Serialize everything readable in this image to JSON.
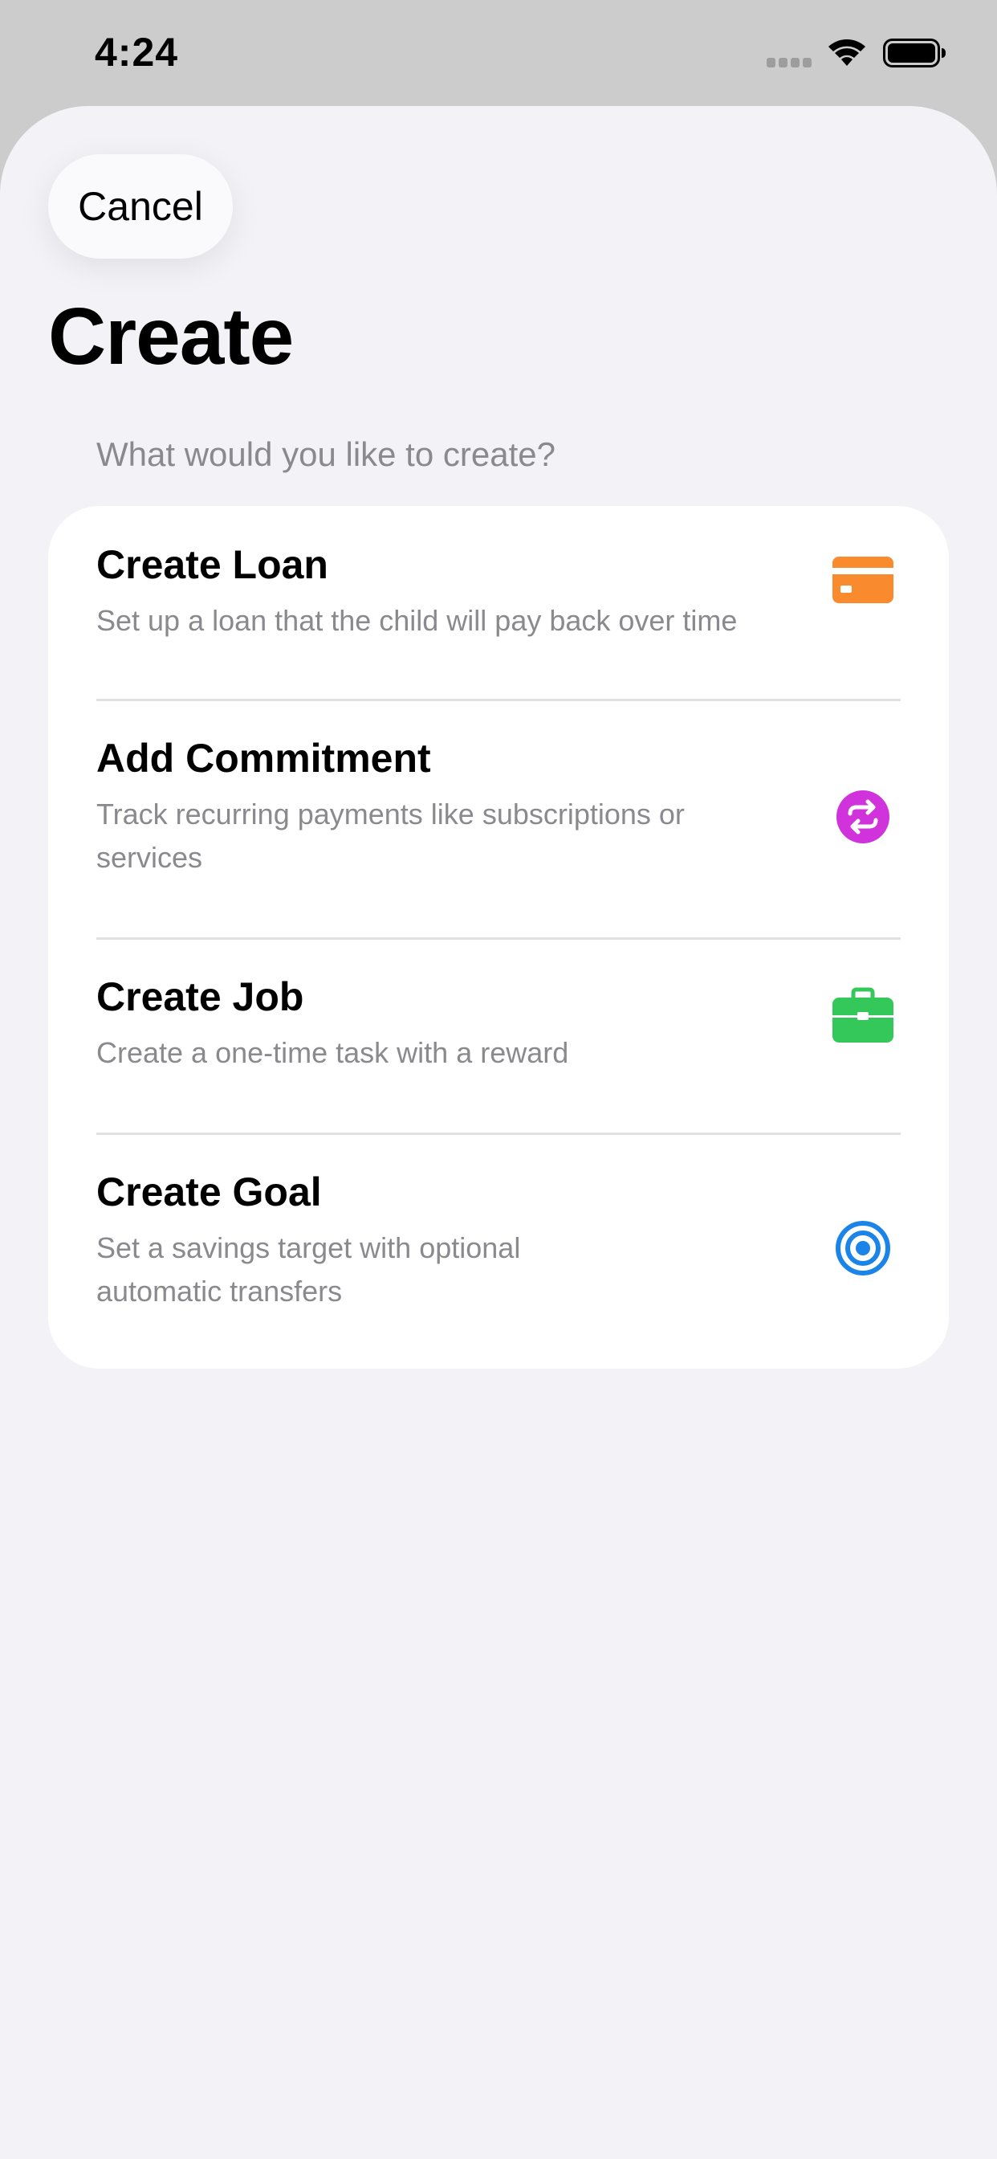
{
  "status_bar": {
    "time": "4:24"
  },
  "sheet": {
    "cancel_label": "Cancel",
    "title": "Create",
    "section_header": "What would you like to create?"
  },
  "options": [
    {
      "title": "Create Loan",
      "subtitle": "Set up a loan that the child will pay back over time",
      "icon": "credit-card-icon",
      "color": "#f98a2d"
    },
    {
      "title": "Add Commitment",
      "subtitle": "Track recurring payments like subscriptions or services",
      "icon": "repeat-icon",
      "color": "#d033dc"
    },
    {
      "title": "Create Job",
      "subtitle": "Create a one-time task with a reward",
      "icon": "briefcase-icon",
      "color": "#34c759"
    },
    {
      "title": "Create Goal",
      "subtitle": "Set a savings target with optional automatic transfers",
      "icon": "target-icon",
      "color": "#1a84e8"
    }
  ]
}
